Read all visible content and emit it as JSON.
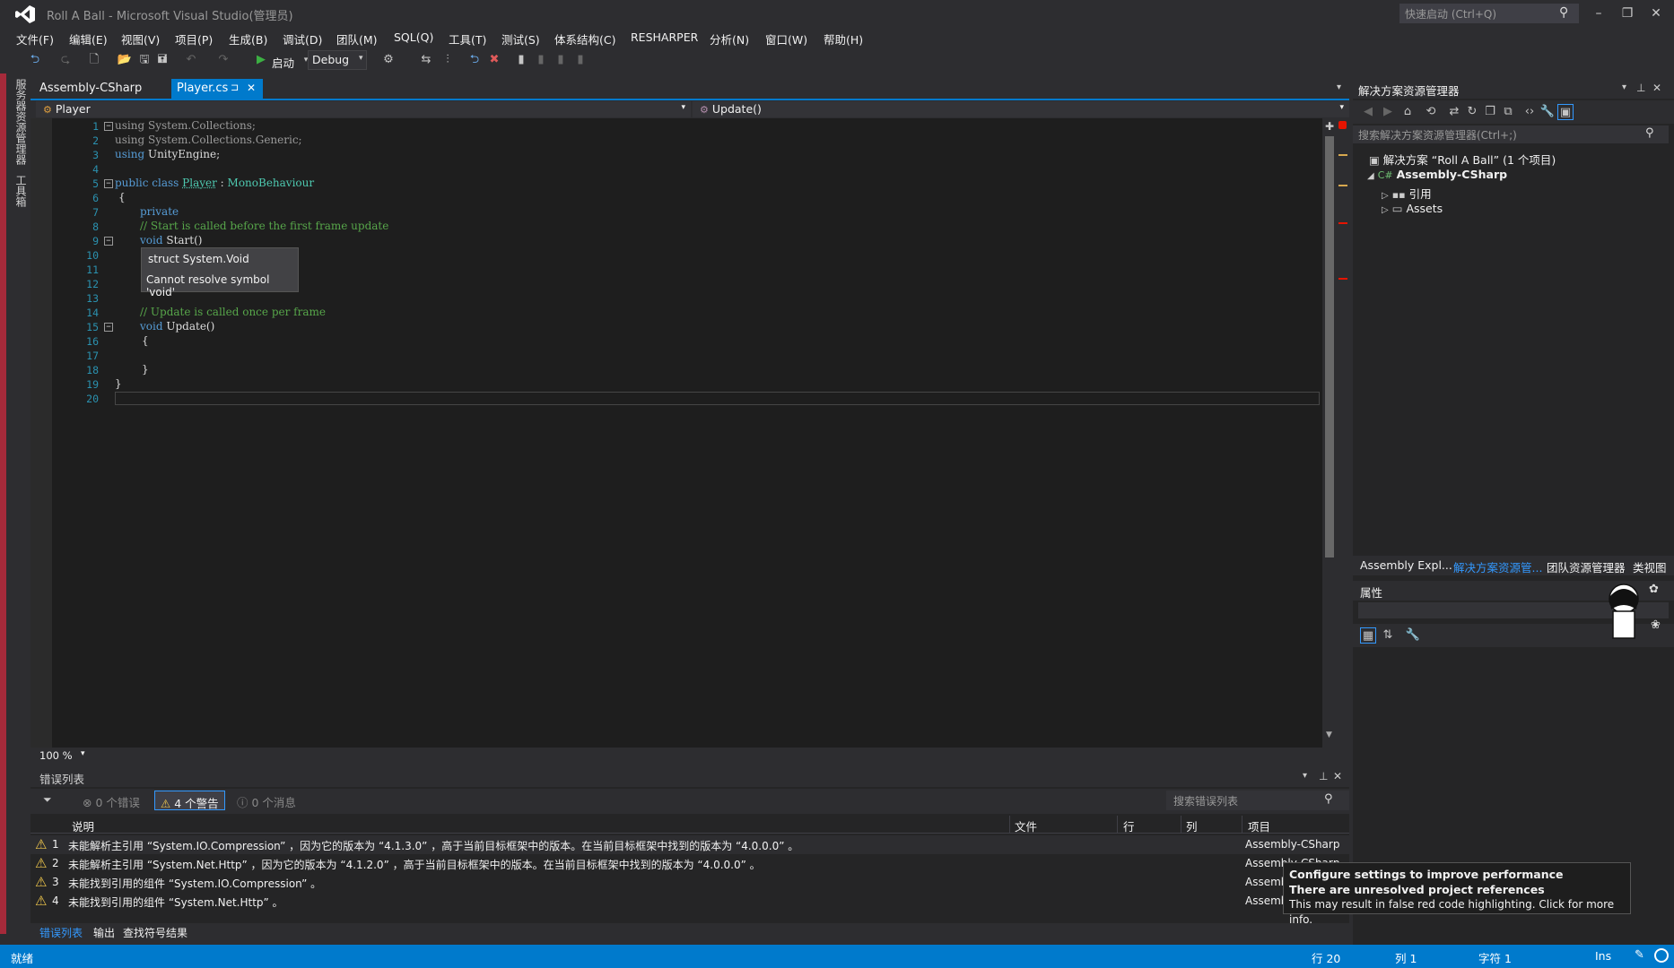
{
  "window": {
    "title": "Roll A Ball - Microsoft Visual Studio(管理员)",
    "quick_launch": "快速启动 (Ctrl+Q)"
  },
  "menu": [
    "文件(F)",
    "编辑(E)",
    "视图(V)",
    "项目(P)",
    "生成(B)",
    "调试(D)",
    "团队(M)",
    "SQL(Q)",
    "工具(T)",
    "测试(S)",
    "体系结构(C)",
    "RESHARPER",
    "分析(N)",
    "窗口(W)",
    "帮助(H)"
  ],
  "toolbar": {
    "start_label": "启动",
    "config": "Debug"
  },
  "side_tabs": [
    "服务器资源管理器",
    "工具箱"
  ],
  "tabs": {
    "project_tab": "Assembly-CSharp",
    "file_tab": "Player.cs",
    "pin": "⊐",
    "close": "✕"
  },
  "nav": {
    "class_dropdown": "Player",
    "member_dropdown": "Update()"
  },
  "code_lines": [
    {
      "n": "1"
    },
    {
      "n": "2"
    },
    {
      "n": "3"
    },
    {
      "n": "4"
    },
    {
      "n": "5"
    },
    {
      "n": "6"
    },
    {
      "n": "7"
    },
    {
      "n": "8"
    },
    {
      "n": "9"
    },
    {
      "n": "10"
    },
    {
      "n": "11"
    },
    {
      "n": "12"
    },
    {
      "n": "13"
    },
    {
      "n": "14"
    },
    {
      "n": "15"
    },
    {
      "n": "16"
    },
    {
      "n": "17"
    },
    {
      "n": "18"
    },
    {
      "n": "19"
    },
    {
      "n": "20"
    }
  ],
  "code": {
    "using": "using",
    "ns1": "System.Collections;",
    "ns2": "System.Collections.Generic;",
    "ns3": "UnityEngine;",
    "public_class": "public class",
    "player": "Player",
    "colon": " : ",
    "mono": "MonoBehaviour",
    "brace_open": "{",
    "brace_close": "}",
    "private": "private",
    "comment_start": "// Start is called before the first frame update",
    "void": "void",
    "start_sig": "Start()",
    "comment_update": "// Update is called once per frame",
    "update_sig": "Update()"
  },
  "tooltip": {
    "line1": "struct System.Void",
    "line2": "Cannot resolve symbol 'void'"
  },
  "zoom": "100 %",
  "error_list": {
    "title": "错误列表",
    "errors_btn": "0 个错误",
    "warnings_btn": "4 个警告",
    "messages_btn": "0 个消息",
    "search_placeholder": "搜索错误列表",
    "columns": {
      "desc": "说明",
      "file": "文件",
      "line": "行",
      "col": "列",
      "project": "项目"
    },
    "rows": [
      {
        "n": "1",
        "desc": "未能解析主引用 “System.IO.Compression” ，因为它的版本为 “4.1.3.0” ，高于当前目标框架中的版本。在当前目标框架中找到的版本为 “4.0.0.0” 。",
        "project": "Assembly-CSharp"
      },
      {
        "n": "2",
        "desc": "未能解析主引用 “System.Net.Http” ，因为它的版本为 “4.1.2.0” ，高于当前目标框架中的版本。在当前目标框架中找到的版本为 “4.0.0.0” 。",
        "project": "Assembly-CSharp"
      },
      {
        "n": "3",
        "desc": "未能找到引用的组件 “System.IO.Compression” 。",
        "project": "Assemb"
      },
      {
        "n": "4",
        "desc": "未能找到引用的组件 “System.Net.Http” 。",
        "project": "Assemb"
      }
    ],
    "tabs": [
      "错误列表",
      "输出",
      "查找符号结果"
    ]
  },
  "solution_explorer": {
    "title": "解决方案资源管理器",
    "search": "搜索解决方案资源管理器(Ctrl+;)",
    "solution": "解决方案 “Roll A Ball” (1 个项目)",
    "project": "Assembly-CSharp",
    "references": "引用",
    "assets": "Assets",
    "tabs": [
      "Assembly Expl...",
      "解决方案资源管...",
      "团队资源管理器",
      "类视图"
    ]
  },
  "properties": {
    "title": "属性"
  },
  "toast": {
    "line1": "Configure settings to improve performance",
    "line2": "There are unresolved project references",
    "line3": "This may result in false red code highlighting. Click for more info."
  },
  "status": {
    "ready": "就绪",
    "line": "行 20",
    "col": "列 1",
    "char": "字符 1",
    "mode": "Ins"
  },
  "colors": {
    "accent": "#007acc",
    "keyword": "#569cd6",
    "type": "#4ec9b0",
    "comment": "#57a64a",
    "warning": "#f2c94c",
    "side_red": "#a52a3a"
  }
}
